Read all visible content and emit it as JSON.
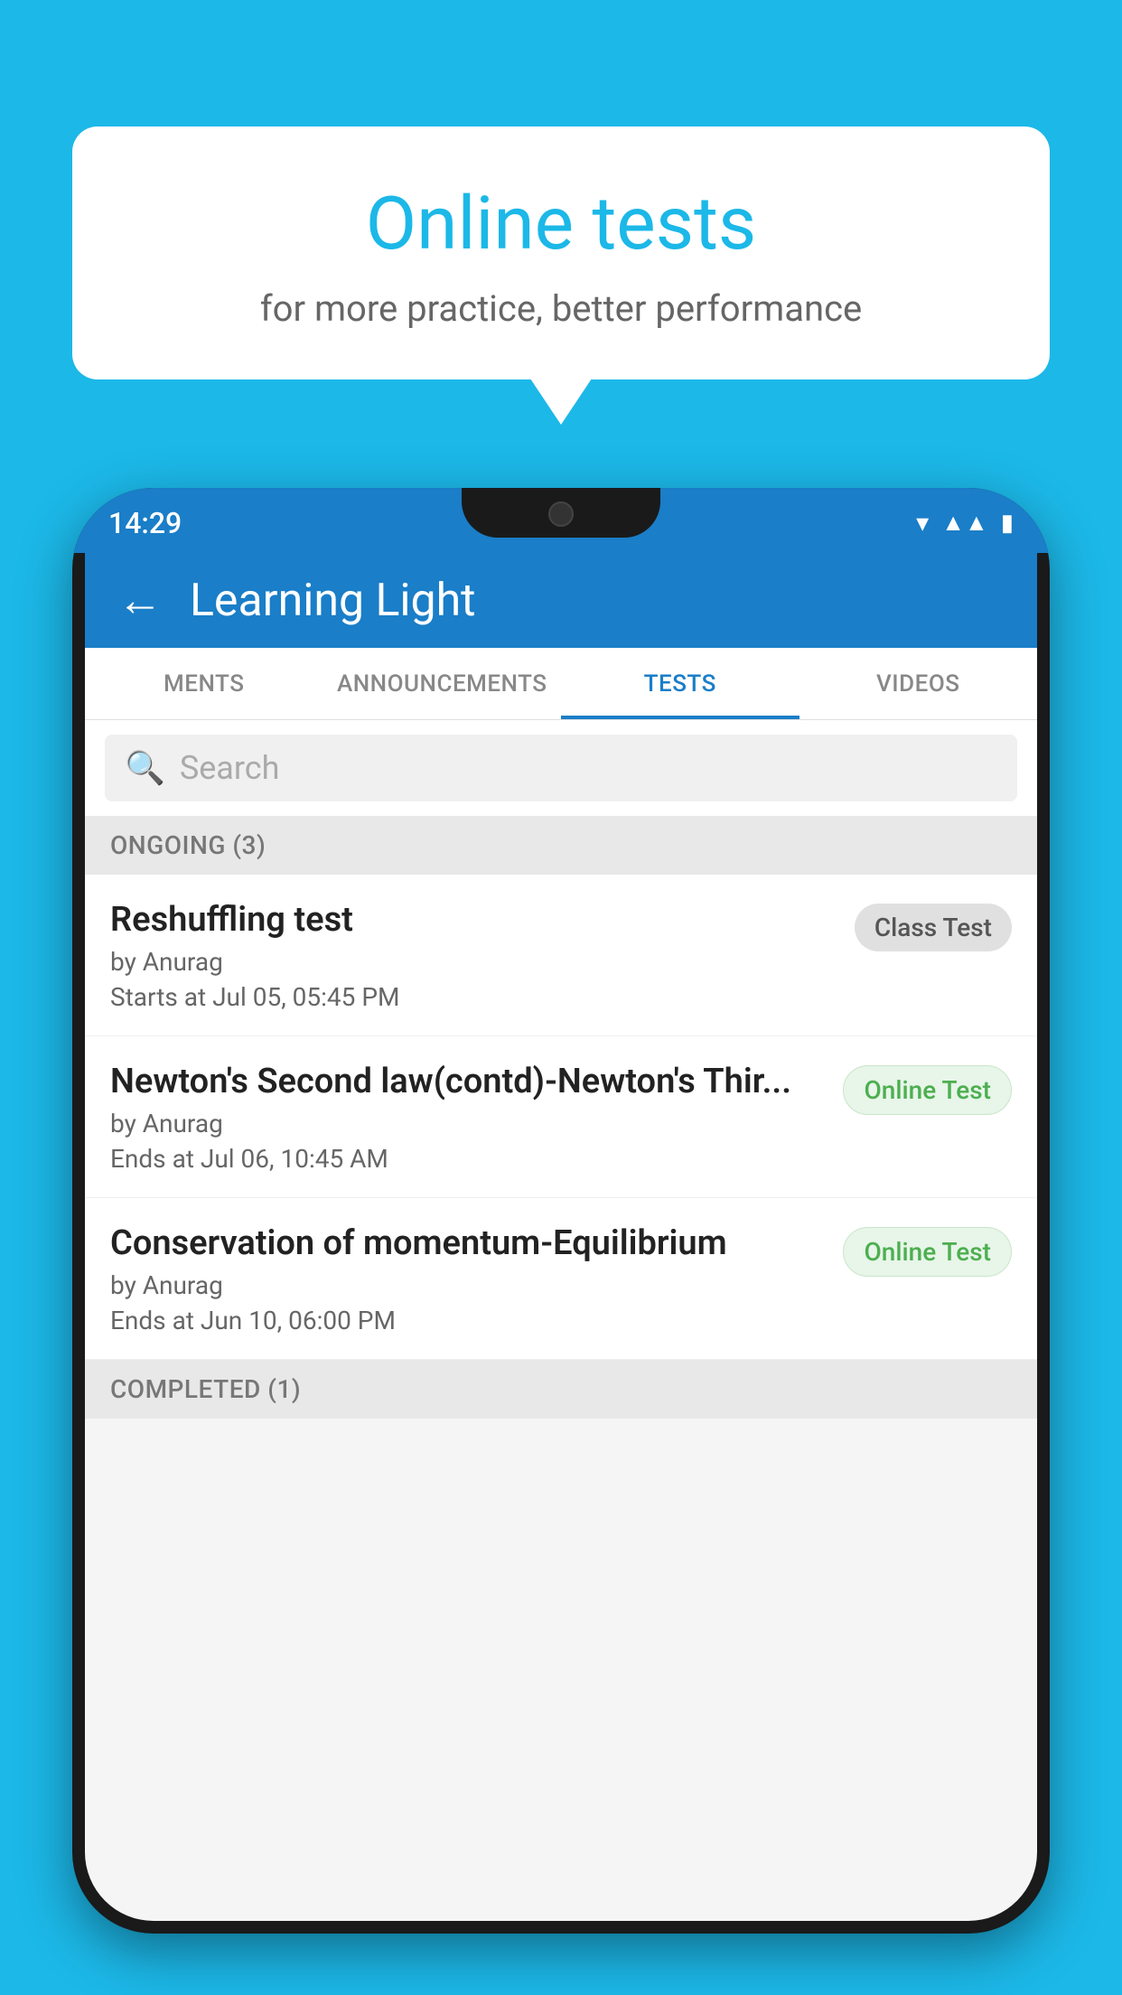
{
  "background_color": "#1cb8e8",
  "bubble": {
    "title": "Online tests",
    "subtitle": "for more practice, better performance"
  },
  "status_bar": {
    "time": "14:29",
    "icons": [
      "wifi",
      "signal",
      "battery"
    ]
  },
  "app_header": {
    "title": "Learning Light",
    "back_label": "←"
  },
  "tabs": [
    {
      "label": "MENTS",
      "active": false
    },
    {
      "label": "ANNOUNCEMENTS",
      "active": false
    },
    {
      "label": "TESTS",
      "active": true
    },
    {
      "label": "VIDEOS",
      "active": false
    }
  ],
  "search": {
    "placeholder": "Search"
  },
  "sections": [
    {
      "title": "ONGOING (3)",
      "tests": [
        {
          "name": "Reshuffling test",
          "author": "by Anurag",
          "time": "Starts at  Jul 05, 05:45 PM",
          "badge": "Class Test",
          "badge_type": "class"
        },
        {
          "name": "Newton's Second law(contd)-Newton's Thir...",
          "author": "by Anurag",
          "time": "Ends at  Jul 06, 10:45 AM",
          "badge": "Online Test",
          "badge_type": "online"
        },
        {
          "name": "Conservation of momentum-Equilibrium",
          "author": "by Anurag",
          "time": "Ends at  Jun 10, 06:00 PM",
          "badge": "Online Test",
          "badge_type": "online"
        }
      ]
    }
  ],
  "completed_section": {
    "title": "COMPLETED (1)"
  }
}
